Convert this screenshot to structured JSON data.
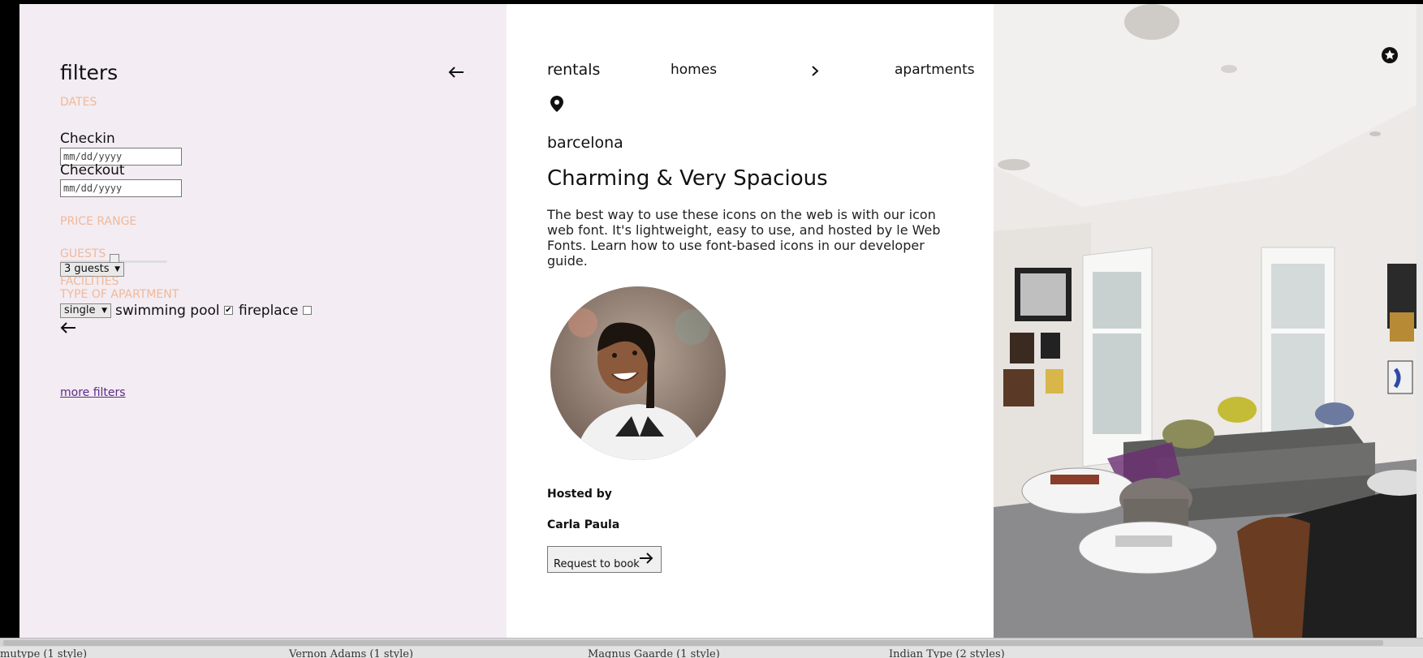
{
  "sidebar": {
    "title": "filters",
    "sections": {
      "dates": "DATES",
      "price_range": "PRICE RANGE",
      "guests": "GUESTS",
      "facilities": "FACILITIES",
      "type_of_apartment": "TYPE OF APARTMENT"
    },
    "checkin_label": "Checkin",
    "checkin_value": "mm/dd/yyyy",
    "checkout_label": "Checkout",
    "checkout_value": "mm/dd/yyyy",
    "price_slider_level": 0.5,
    "guests_selected": "3 guests",
    "apartment_type_selected": "single",
    "swimming_pool_label": "swimming pool",
    "swimming_pool_checked": true,
    "fireplace_label": "fireplace",
    "fireplace_checked": false,
    "more_filters": "more filters"
  },
  "main": {
    "nav": {
      "rentals": "rentals",
      "homes": "homes",
      "apartments": "apartments"
    },
    "location": "barcelona",
    "title": "Charming & Very Spacious",
    "description": "The best way to use these icons on the web is with our icon web font. It's lightweight, easy to use, and hosted by le Web Fonts. Learn how to use font-based icons in our developer guide.",
    "hosted_by_label": "Hosted by",
    "host_name": "Carla Paula",
    "book_button": "Request to book"
  },
  "colors": {
    "sidebar_bg": "#f3ecf3",
    "section_label": "#f0b99a",
    "link": "#5b2a86"
  },
  "taskbar": {
    "items": [
      "mutype (1 style)",
      "Vernon Adams (1 style)",
      "Magnus Gaarde (1 style)",
      "Indian Type (2 styles)"
    ]
  }
}
